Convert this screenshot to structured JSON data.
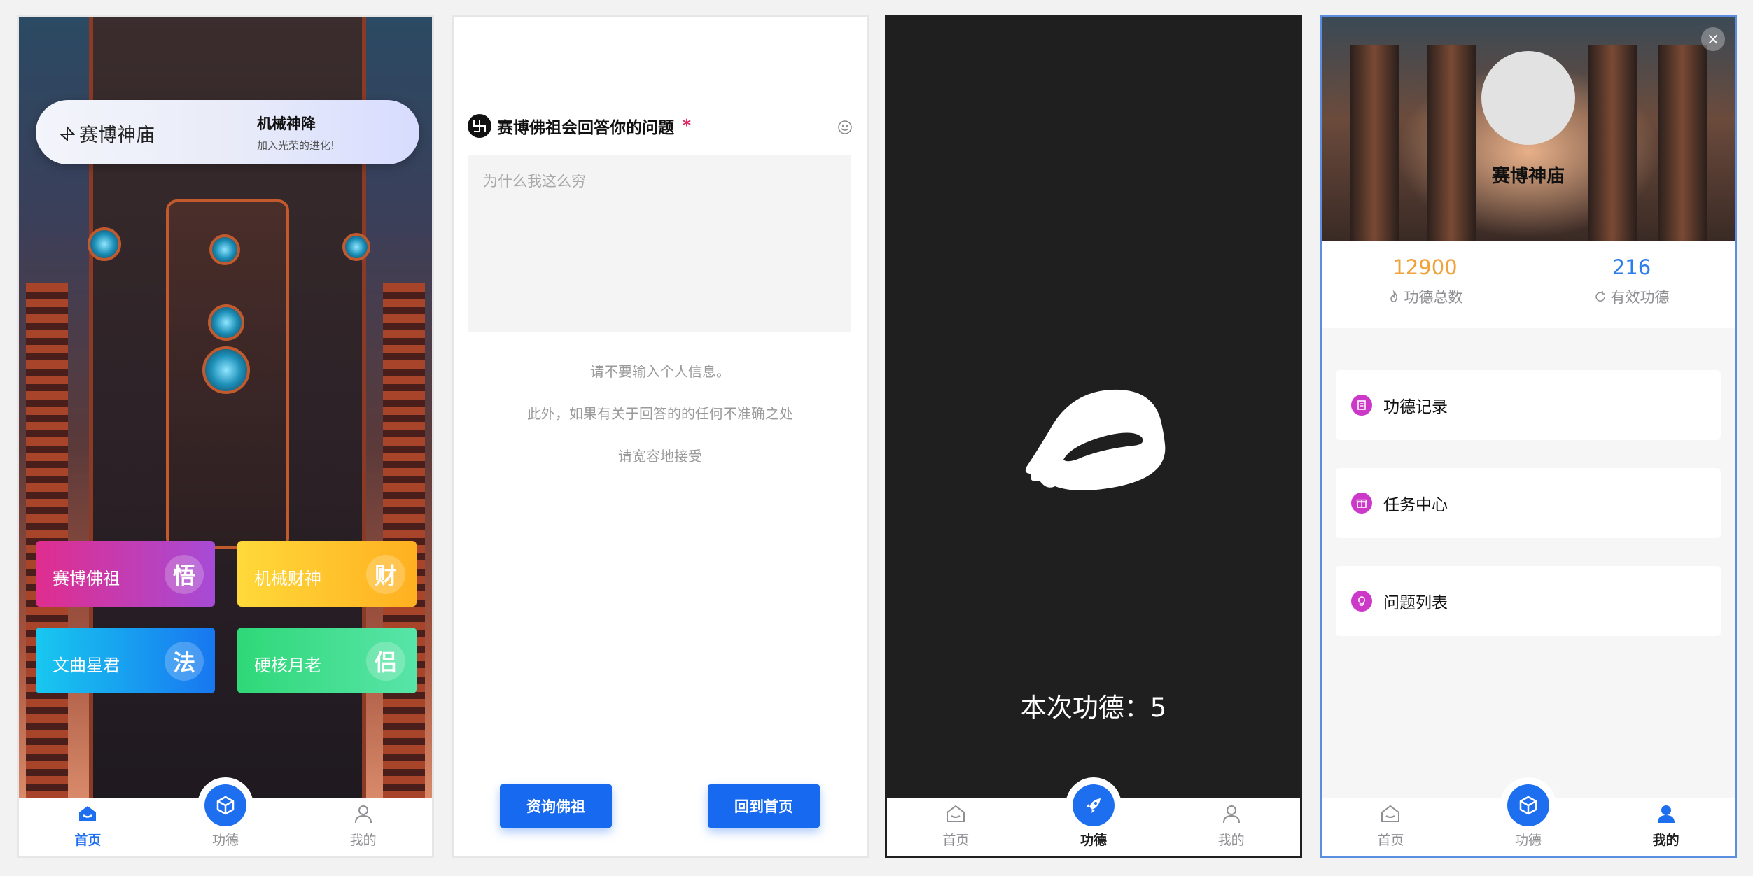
{
  "tabbar": {
    "home": "首页",
    "merit": "功德",
    "mine": "我的"
  },
  "home": {
    "banner": {
      "brand": "赛博神庙",
      "title": "机械神降",
      "subtitle": "加入光荣的进化!"
    },
    "cards": [
      {
        "label": "赛博佛祖",
        "char": "悟"
      },
      {
        "label": "机械财神",
        "char": "财"
      },
      {
        "label": "文曲星君",
        "char": "法"
      },
      {
        "label": "硬核月老",
        "char": "侣"
      }
    ]
  },
  "ask": {
    "title": "赛博佛祖会回答你的问题",
    "required_mark": "*",
    "placeholder": "为什么我这么穷",
    "notes": [
      "请不要输入个人信息。",
      "此外，如果有关于回答的的任何不准确之处",
      "请宽容地接受"
    ],
    "ask_button": "资询佛祖",
    "home_button": "回到首页"
  },
  "merit_screen": {
    "text": "本次功德：5"
  },
  "profile": {
    "name": "赛博神庙",
    "stats": [
      {
        "value": "12900",
        "label": "功德总数",
        "color": "#f2a23a"
      },
      {
        "value": "216",
        "label": "有效功德",
        "color": "#2b7de9"
      }
    ],
    "menu": [
      "功德记录",
      "任务中心",
      "问题列表"
    ],
    "close": "×"
  }
}
